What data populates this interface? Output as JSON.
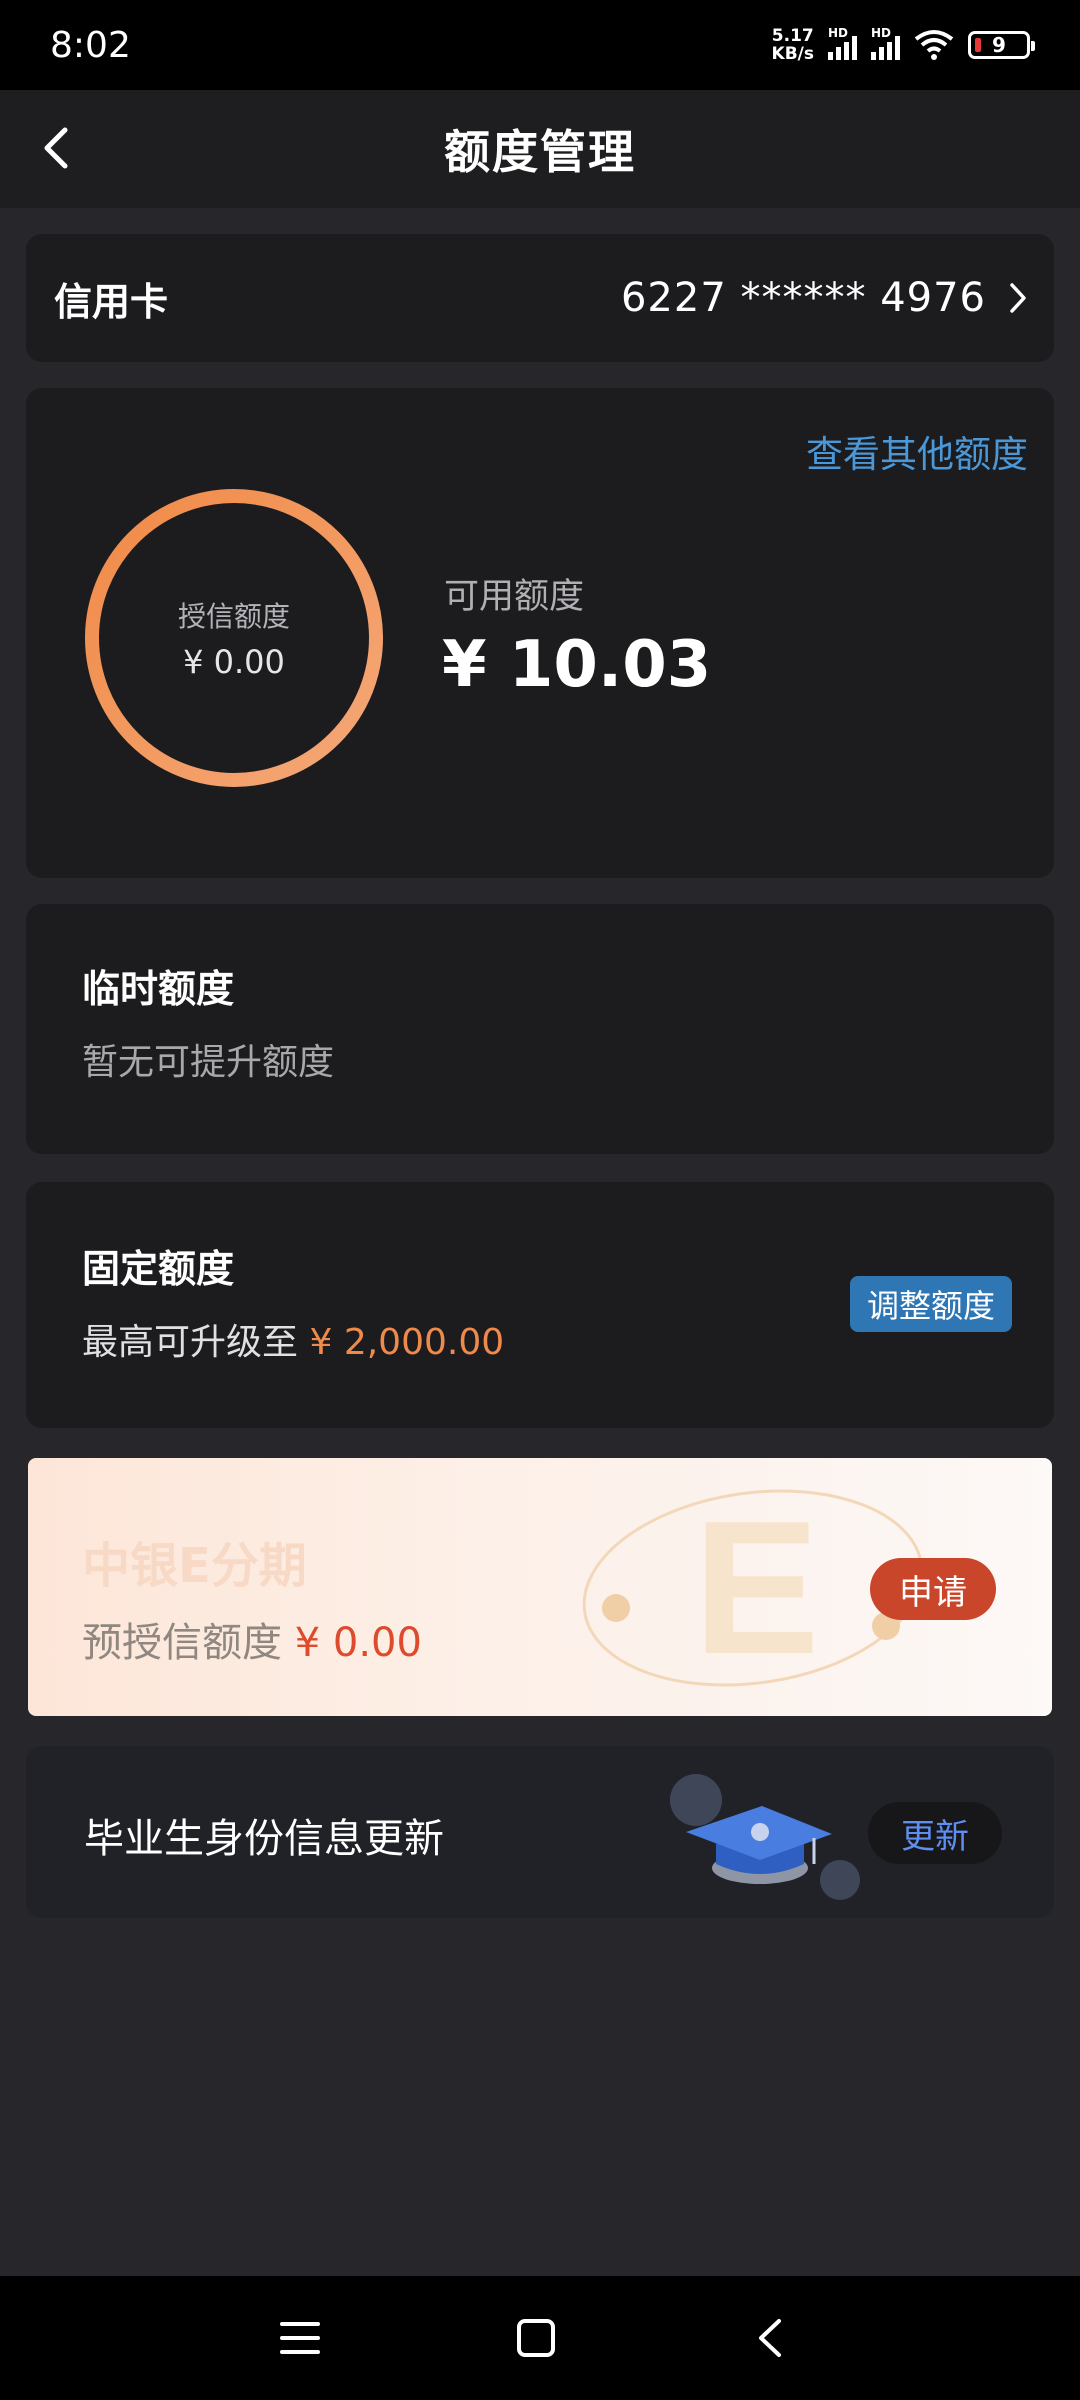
{
  "status_bar": {
    "time": "8:02",
    "net_speed_value": "5.17",
    "net_speed_unit": "KB/s",
    "hd1": "HD",
    "hd2": "HD",
    "battery": "9"
  },
  "header": {
    "title": "额度管理"
  },
  "credit_card": {
    "label": "信用卡",
    "card_number": "6227 ****** 4976"
  },
  "limit_summary": {
    "view_other_link": "查看其他额度",
    "granted_label": "授信额度",
    "granted_value": "¥ 0.00",
    "available_label": "可用额度",
    "available_value": "¥ 10.03",
    "ring_color": "#f0955a"
  },
  "temporary_limit": {
    "title": "临时额度",
    "subtitle": "暂无可提升额度"
  },
  "fixed_limit": {
    "title": "固定额度",
    "subtitle_prefix": "最高可升级至",
    "max_amount": "¥ 2,000.00",
    "adjust_button": "调整额度"
  },
  "installment_promo": {
    "title": "中银E分期",
    "subtitle_prefix": "预授信额度",
    "amount": "¥ 0.00",
    "apply_button": "申请"
  },
  "graduate_update": {
    "title": "毕业生身份信息更新",
    "update_button": "更新"
  },
  "colors": {
    "accent_orange": "#ef8a4b",
    "link_blue": "#4a98d8",
    "apply_red": "#c9462a",
    "update_blue": "#5e8ef0"
  }
}
